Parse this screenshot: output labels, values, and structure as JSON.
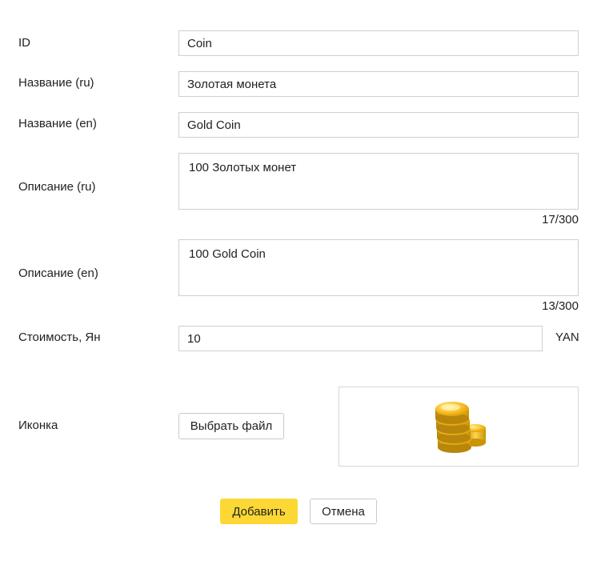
{
  "form": {
    "id": {
      "label": "ID",
      "value": "Coin"
    },
    "name_ru": {
      "label": "Название (ru)",
      "value": "Золотая монета"
    },
    "name_en": {
      "label": "Название (en)",
      "value": "Gold Coin"
    },
    "description_ru": {
      "label": "Описание (ru)",
      "value": "100 Золотых монет",
      "counter": "17/300"
    },
    "description_en": {
      "label": "Описание (en)",
      "value": "100 Gold Coin",
      "counter": "13/300"
    },
    "price": {
      "label": "Стоимость, Ян",
      "value": "10",
      "suffix": "YAN"
    },
    "icon": {
      "label": "Иконка",
      "choose_file_label": "Выбрать файл",
      "preview_icon": "gold-coins-icon"
    }
  },
  "actions": {
    "add_label": "Добавить",
    "cancel_label": "Отмена"
  },
  "colors": {
    "primary_button": "#fdd835",
    "border": "#cfcfcf",
    "coin_gold": "#f5c518"
  }
}
